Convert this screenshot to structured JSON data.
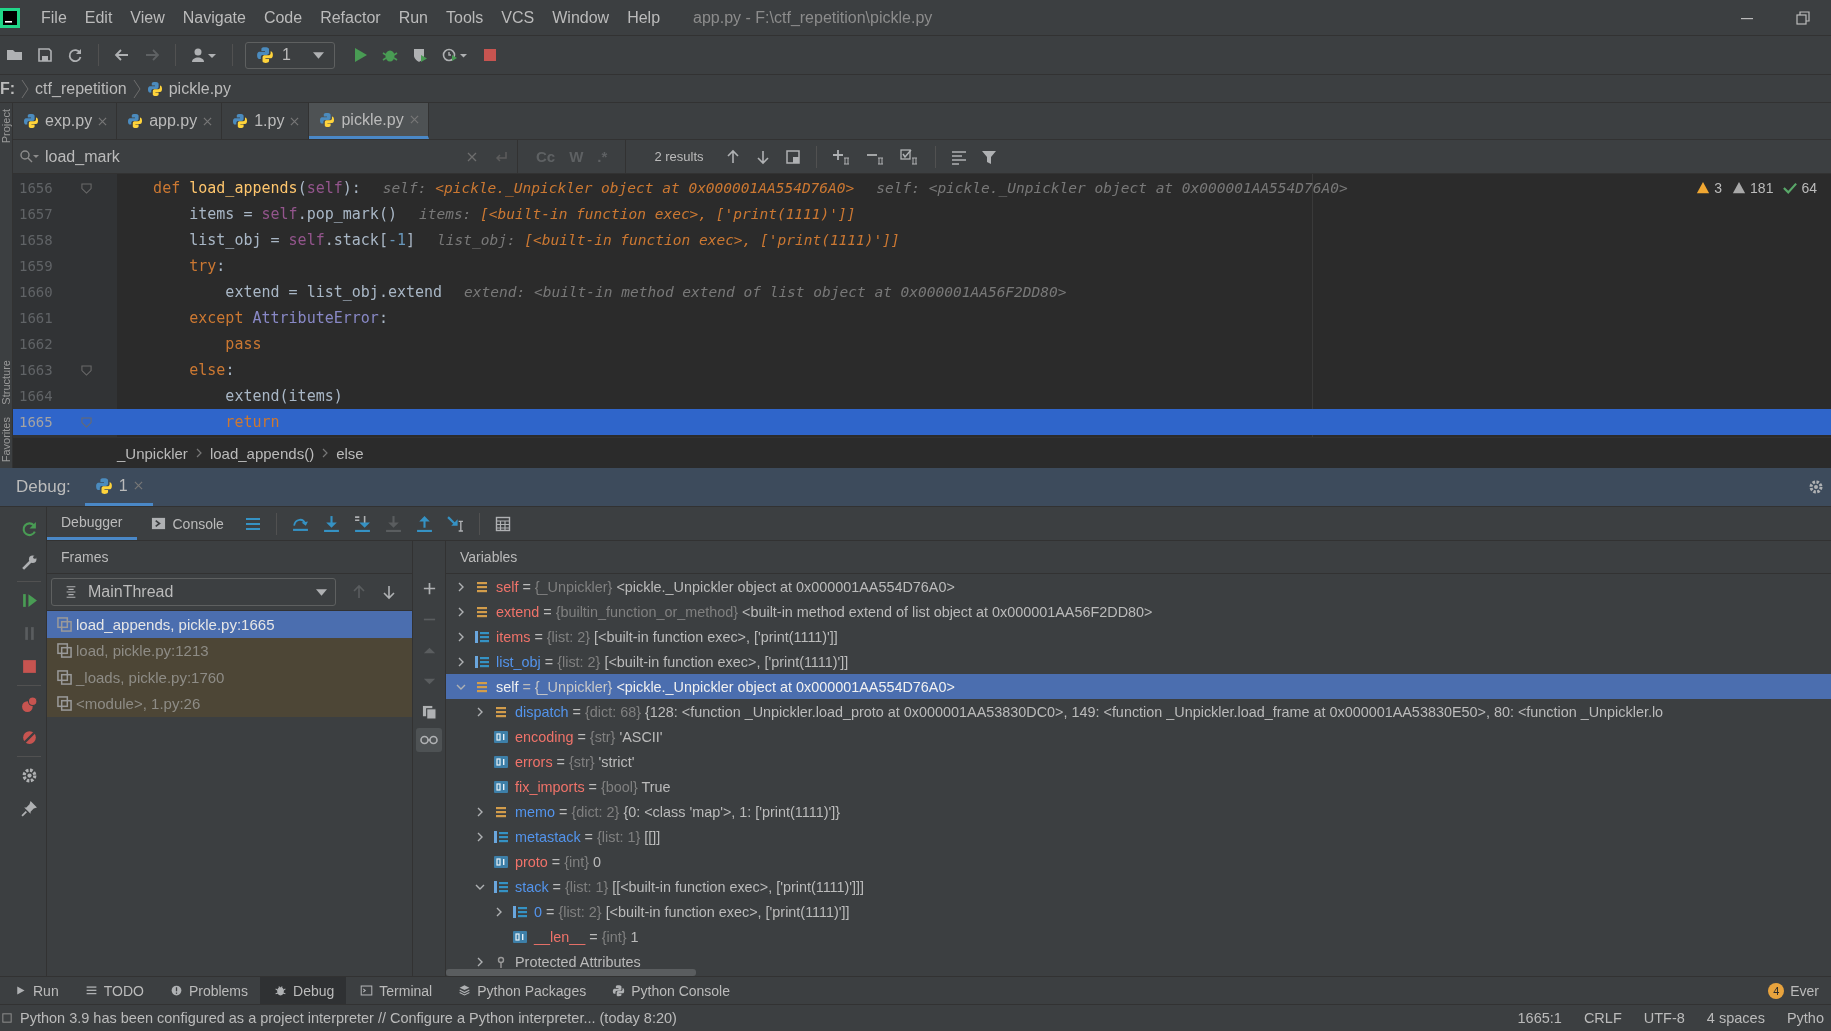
{
  "window": {
    "title": "app.py - F:\\ctf_repetition\\pickle.py"
  },
  "menu": [
    "File",
    "Edit",
    "View",
    "Navigate",
    "Code",
    "Refactor",
    "Run",
    "Tools",
    "VCS",
    "Window",
    "Help"
  ],
  "toolbar": {
    "run_config": "1"
  },
  "nav_path": [
    "F:",
    "ctf_repetition",
    "pickle.py"
  ],
  "side_tabs": {
    "top": [
      "Project"
    ],
    "bottom": [
      "Structure",
      "Favorites"
    ]
  },
  "tabs": [
    {
      "label": "exp.py",
      "selected": false
    },
    {
      "label": "app.py",
      "selected": false
    },
    {
      "label": "1.py",
      "selected": false
    },
    {
      "label": "pickle.py",
      "selected": true
    }
  ],
  "search": {
    "value": "load_mark",
    "results": "2 results",
    "options": [
      "Cc",
      "W",
      ".*"
    ]
  },
  "inspections": [
    {
      "kind": "warning",
      "count": "3"
    },
    {
      "kind": "weak",
      "count": "181"
    },
    {
      "kind": "ok",
      "count": "64"
    }
  ],
  "code_lines": [
    {
      "number": "1656",
      "fold": true,
      "selected": false,
      "tokens": [
        {
          "kind": "kw",
          "text": "    def "
        },
        {
          "kind": "fn",
          "text": "load_appends"
        },
        {
          "kind": "plain",
          "text": "("
        },
        {
          "kind": "self",
          "text": "self"
        },
        {
          "kind": "plain",
          "text": "):"
        }
      ],
      "hints": [
        {
          "label": "self:",
          "value": "<pickle._Unpickler object at 0x000001AA554D76A0>",
          "kind": "value"
        },
        {
          "label": "self:",
          "value": "<pickle._Unpickler object at 0x000001AA554D76A0>",
          "kind": "muted"
        }
      ]
    },
    {
      "number": "1657",
      "fold": false,
      "selected": false,
      "tokens": [
        {
          "kind": "plain",
          "text": "        items = "
        },
        {
          "kind": "self",
          "text": "self"
        },
        {
          "kind": "plain",
          "text": ".pop_mark()"
        }
      ],
      "hints": [
        {
          "label": "items:",
          "value": "[<built-in function exec>, ['print(1111)']]",
          "kind": "value"
        }
      ]
    },
    {
      "number": "1658",
      "fold": false,
      "selected": false,
      "tokens": [
        {
          "kind": "plain",
          "text": "        list_obj = "
        },
        {
          "kind": "self",
          "text": "self"
        },
        {
          "kind": "plain",
          "text": ".stack["
        },
        {
          "kind": "num",
          "text": "-1"
        },
        {
          "kind": "plain",
          "text": "]"
        }
      ],
      "hints": [
        {
          "label": "list_obj:",
          "value": "[<built-in function exec>, ['print(1111)']]",
          "kind": "value"
        }
      ]
    },
    {
      "number": "1659",
      "fold": false,
      "selected": false,
      "tokens": [
        {
          "kind": "kw",
          "text": "        try"
        },
        {
          "kind": "plain",
          "text": ":"
        }
      ]
    },
    {
      "number": "1660",
      "fold": false,
      "selected": false,
      "tokens": [
        {
          "kind": "plain",
          "text": "            extend = list_obj.extend"
        }
      ],
      "hints": [
        {
          "label": "extend:",
          "value": "<built-in method extend of list object at 0x000001AA56F2DD80>",
          "kind": "muted"
        }
      ]
    },
    {
      "number": "1661",
      "fold": false,
      "selected": false,
      "tokens": [
        {
          "kind": "kw",
          "text": "        except "
        },
        {
          "kind": "cls",
          "text": "AttributeError"
        },
        {
          "kind": "plain",
          "text": ":"
        }
      ]
    },
    {
      "number": "1662",
      "fold": false,
      "selected": false,
      "tokens": [
        {
          "kind": "kw",
          "text": "            pass"
        }
      ]
    },
    {
      "number": "1663",
      "fold": true,
      "selected": false,
      "tokens": [
        {
          "kind": "kw",
          "text": "        else"
        },
        {
          "kind": "plain",
          "text": ":"
        }
      ]
    },
    {
      "number": "1664",
      "fold": false,
      "selected": false,
      "tokens": [
        {
          "kind": "plain",
          "text": "            extend(items)"
        }
      ]
    },
    {
      "number": "1665",
      "fold": true,
      "selected": true,
      "tokens": [
        {
          "kind": "kw",
          "text": "            return"
        }
      ]
    }
  ],
  "code_path": [
    "_Unpickler",
    "load_appends()",
    "else"
  ],
  "debug": {
    "label": "Debug:",
    "session": "1",
    "tabs": [
      {
        "label": "Debugger",
        "selected": true
      },
      {
        "label": "Console",
        "selected": false
      }
    ],
    "frames_title": "Frames",
    "thread": "MainThread",
    "frames": [
      {
        "label": "load_appends, pickle.py:1665",
        "selected": true,
        "library": false
      },
      {
        "label": "load, pickle.py:1213",
        "selected": false,
        "library": true
      },
      {
        "label": "_loads, pickle.py:1760",
        "selected": false,
        "library": true
      },
      {
        "label": "<module>, 1.py:26",
        "selected": false,
        "library": true
      }
    ],
    "variables_title": "Variables",
    "assign_sign": "=",
    "variables": [
      {
        "name": "self",
        "type": "{_Unpickler}",
        "value": "<pickle._Unpickler object at 0x000001AA554D76A0>",
        "kind": "object",
        "changed": true,
        "expanded": false,
        "selected": false
      },
      {
        "name": "extend",
        "type": "{builtin_function_or_method}",
        "value": "<built-in method extend of list object at 0x000001AA56F2DD80>",
        "kind": "object",
        "changed": true,
        "expanded": false,
        "selected": false
      },
      {
        "name": "items",
        "type": "{list: 2}",
        "value": "[<built-in function exec>, ['print(1111)']]",
        "kind": "list",
        "changed": true,
        "expanded": false,
        "selected": false
      },
      {
        "name": "list_obj",
        "type": "{list: 2}",
        "value": "[<built-in function exec>, ['print(1111)']]",
        "kind": "list",
        "changed": false,
        "expanded": false,
        "selected": false
      },
      {
        "name": "self",
        "type": "{_Unpickler}",
        "value": "<pickle._Unpickler object at 0x000001AA554D76A0>",
        "kind": "object",
        "changed": true,
        "expanded": true,
        "selected": true,
        "children": [
          {
            "name": "dispatch",
            "type": "{dict: 68}",
            "value": "{128: <function _Unpickler.load_proto at 0x000001AA53830DC0>, 149: <function _Unpickler.load_frame at 0x000001AA53830E50>, 80: <function _Unpickler.lo",
            "kind": "object",
            "changed": false,
            "expanded": false,
            "selected": false
          },
          {
            "name": "encoding",
            "type": "{str}",
            "value": "'ASCII'",
            "kind": "scalar",
            "changed": true,
            "selected": false
          },
          {
            "name": "errors",
            "type": "{str}",
            "value": "'strict'",
            "kind": "scalar",
            "changed": true,
            "selected": false
          },
          {
            "name": "fix_imports",
            "type": "{bool}",
            "value": "True",
            "kind": "scalar",
            "changed": true,
            "selected": false
          },
          {
            "name": "memo",
            "type": "{dict: 2}",
            "value": "{0: <class 'map'>, 1: ['print(1111)']}",
            "kind": "object",
            "changed": false,
            "expanded": false,
            "selected": false
          },
          {
            "name": "metastack",
            "type": "{list: 1}",
            "value": "[[]]",
            "kind": "list",
            "changed": false,
            "expanded": false,
            "selected": false
          },
          {
            "name": "proto",
            "type": "{int}",
            "value": "0",
            "kind": "scalar",
            "changed": true,
            "selected": false
          },
          {
            "name": "stack",
            "type": "{list: 1}",
            "value": "[[<built-in function exec>, ['print(1111)']]]",
            "kind": "list",
            "changed": false,
            "expanded": true,
            "selected": false,
            "children": [
              {
                "name": "0",
                "type": "{list: 2}",
                "value": "[<built-in function exec>, ['print(1111)']]",
                "kind": "list",
                "changed": false,
                "expanded": false,
                "selected": false
              },
              {
                "name": "__len__",
                "type": "{int}",
                "value": "1",
                "kind": "scalar",
                "changed": true,
                "selected": false
              }
            ]
          },
          {
            "name": "Protected Attributes",
            "kind": "group",
            "expanded": false,
            "selected": false
          }
        ]
      }
    ]
  },
  "tool_tabs": [
    {
      "label": "Run",
      "kind": "run",
      "selected": false
    },
    {
      "label": "TODO",
      "kind": "todo",
      "selected": false
    },
    {
      "label": "Problems",
      "kind": "problems",
      "selected": false
    },
    {
      "label": "Debug",
      "kind": "debug",
      "selected": true
    },
    {
      "label": "Terminal",
      "kind": "terminal",
      "selected": false
    },
    {
      "label": "Python Packages",
      "kind": "packages",
      "selected": false
    },
    {
      "label": "Python Console",
      "kind": "console",
      "selected": false
    }
  ],
  "event_log": {
    "label": "Ever",
    "count": "4"
  },
  "status": {
    "message": "Python 3.9 has been configured as a project interpreter // Configure a Python interpreter... (today 8:20)",
    "items": [
      "1665:1",
      "CRLF",
      "UTF-8",
      "4 spaces",
      "Pytho"
    ]
  }
}
